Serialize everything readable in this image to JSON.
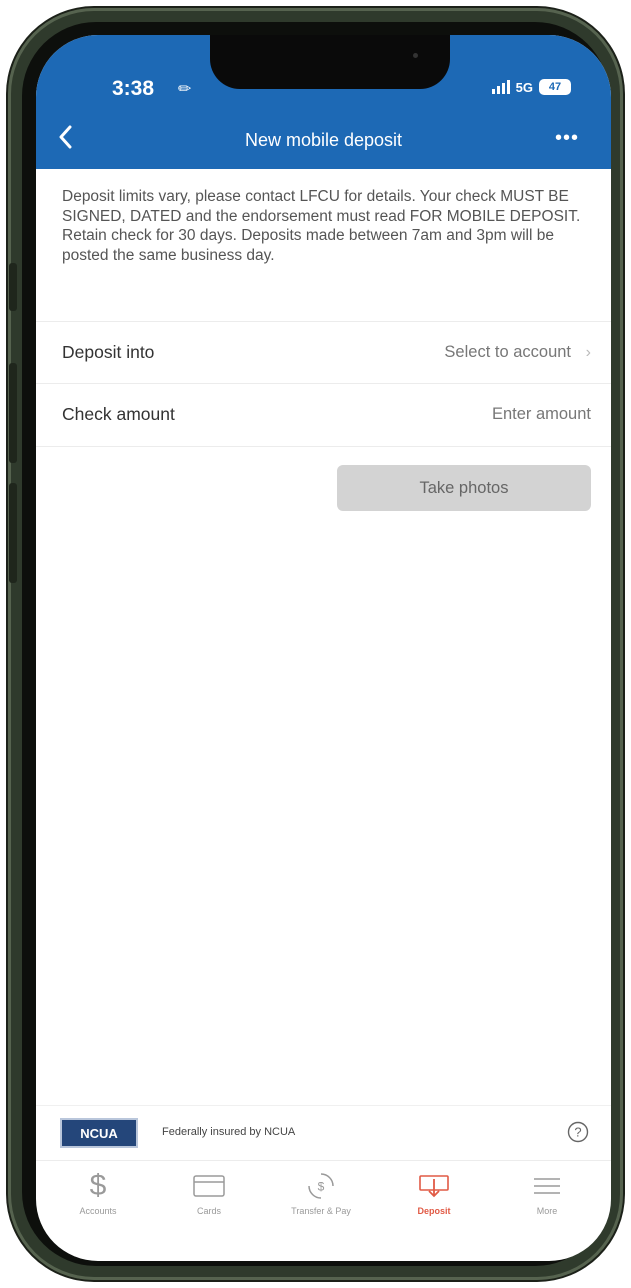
{
  "status_bar": {
    "time": "3:38",
    "network": "5G",
    "battery": "47"
  },
  "header": {
    "title": "New mobile deposit",
    "more_label": "•••"
  },
  "notice": "Deposit limits vary, please contact LFCU for details. Your check MUST BE SIGNED, DATED and the endorsement must read FOR MOBILE DEPOSIT. Retain check for 30 days. Deposits made between 7am and 3pm will be posted the same business day.",
  "form": {
    "deposit_into": {
      "label": "Deposit into",
      "value": "Select to account"
    },
    "check_amount": {
      "label": "Check amount",
      "placeholder": "Enter amount"
    },
    "take_photos_label": "Take photos"
  },
  "footer": {
    "ncua_logo": "NCUA",
    "ncua_text": "Federally insured by NCUA"
  },
  "tabs": [
    {
      "label": "Accounts",
      "icon": "dollar-icon"
    },
    {
      "label": "Cards",
      "icon": "card-icon"
    },
    {
      "label": "Transfer & Pay",
      "icon": "transfer-icon"
    },
    {
      "label": "Deposit",
      "icon": "deposit-icon"
    },
    {
      "label": "More",
      "icon": "menu-icon"
    }
  ],
  "colors": {
    "header": "#1d69b5",
    "active_tab": "#e15a45",
    "button_disabled": "#d3d3d3"
  }
}
